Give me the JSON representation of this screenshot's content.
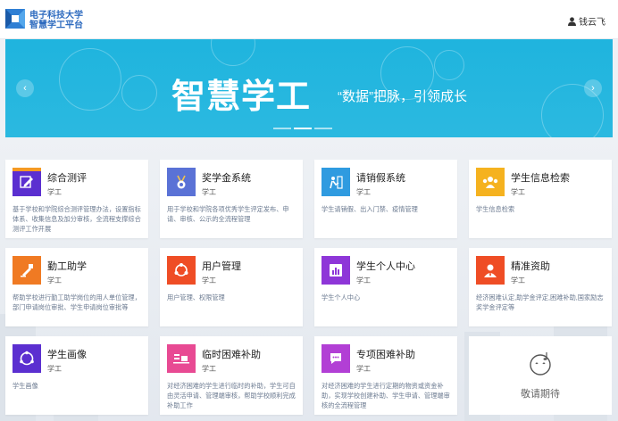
{
  "header": {
    "logo_line1": "电子科技大学",
    "logo_line2": "智慧学工平台",
    "username": "钱云飞"
  },
  "banner": {
    "title": "智慧学工",
    "subtitle": "“数据”把脉，引领成长",
    "prev": "‹",
    "next": "›"
  },
  "apps": [
    {
      "name": "综合测评",
      "category": "学工",
      "desc": "基于学校和学院综合测评管理办法，设置指标体系、收集信息及加分审核，全流程支撑综合测评工作开展",
      "icon": "edit-icon",
      "color": "#5b2fd0",
      "accent": "#f59a23"
    },
    {
      "name": "奖学金系统",
      "category": "学工",
      "desc": "用于学校和学院各项优秀学生评定发布、申请、审核、公示的全流程管理",
      "icon": "medal-icon",
      "color": "#5a72d6",
      "accent": "#f2c34a"
    },
    {
      "name": "请销假系统",
      "category": "学工",
      "desc": "学生请销假、出入门禁、疫情管理",
      "icon": "leave-icon",
      "color": "#2f9be0",
      "accent": ""
    },
    {
      "name": "学生信息检索",
      "category": "学工",
      "desc": "学生信息检索",
      "icon": "people-icon",
      "color": "#f5b21f",
      "accent": ""
    },
    {
      "name": "勤工助学",
      "category": "学工",
      "desc": "帮助学校进行勤工助学岗位的用人单位管理，部门申请岗位审批、学生申请岗位审批等",
      "icon": "work-icon",
      "color": "#f07a23",
      "accent": ""
    },
    {
      "name": "用户管理",
      "category": "学工",
      "desc": "用户管理、权限管理",
      "icon": "share-icon",
      "color": "#ef4d25",
      "accent": ""
    },
    {
      "name": "学生个人中心",
      "category": "学工",
      "desc": "学生个人中心",
      "icon": "chart-icon",
      "color": "#8e36d8",
      "accent": ""
    },
    {
      "name": "精准资助",
      "category": "学工",
      "desc": "经济困难认定,助学金评定,困难补助,国家励志奖学金评定等",
      "icon": "person-icon",
      "color": "#ef4d25",
      "accent": ""
    },
    {
      "name": "学生画像",
      "category": "学工",
      "desc": "学生画像",
      "icon": "portrait-icon",
      "color": "#5b2fd0",
      "accent": ""
    },
    {
      "name": "临时困难补助",
      "category": "学工",
      "desc": "对经济困难的学生进行临时的补助，学生可自由灵活申请、管理端审核，帮助学校顺利完成补助工作",
      "icon": "temp-aid-icon",
      "color": "#e84a93",
      "accent": ""
    },
    {
      "name": "专项困难补助",
      "category": "学工",
      "desc": "对经济困难的学生进行定期的物资或资金补助，实现学校创建补助、学生申请、管理端审核的全流程管理",
      "icon": "chat-icon",
      "color": "#b23fd5",
      "accent": ""
    }
  ],
  "coming_soon": "敬请期待"
}
